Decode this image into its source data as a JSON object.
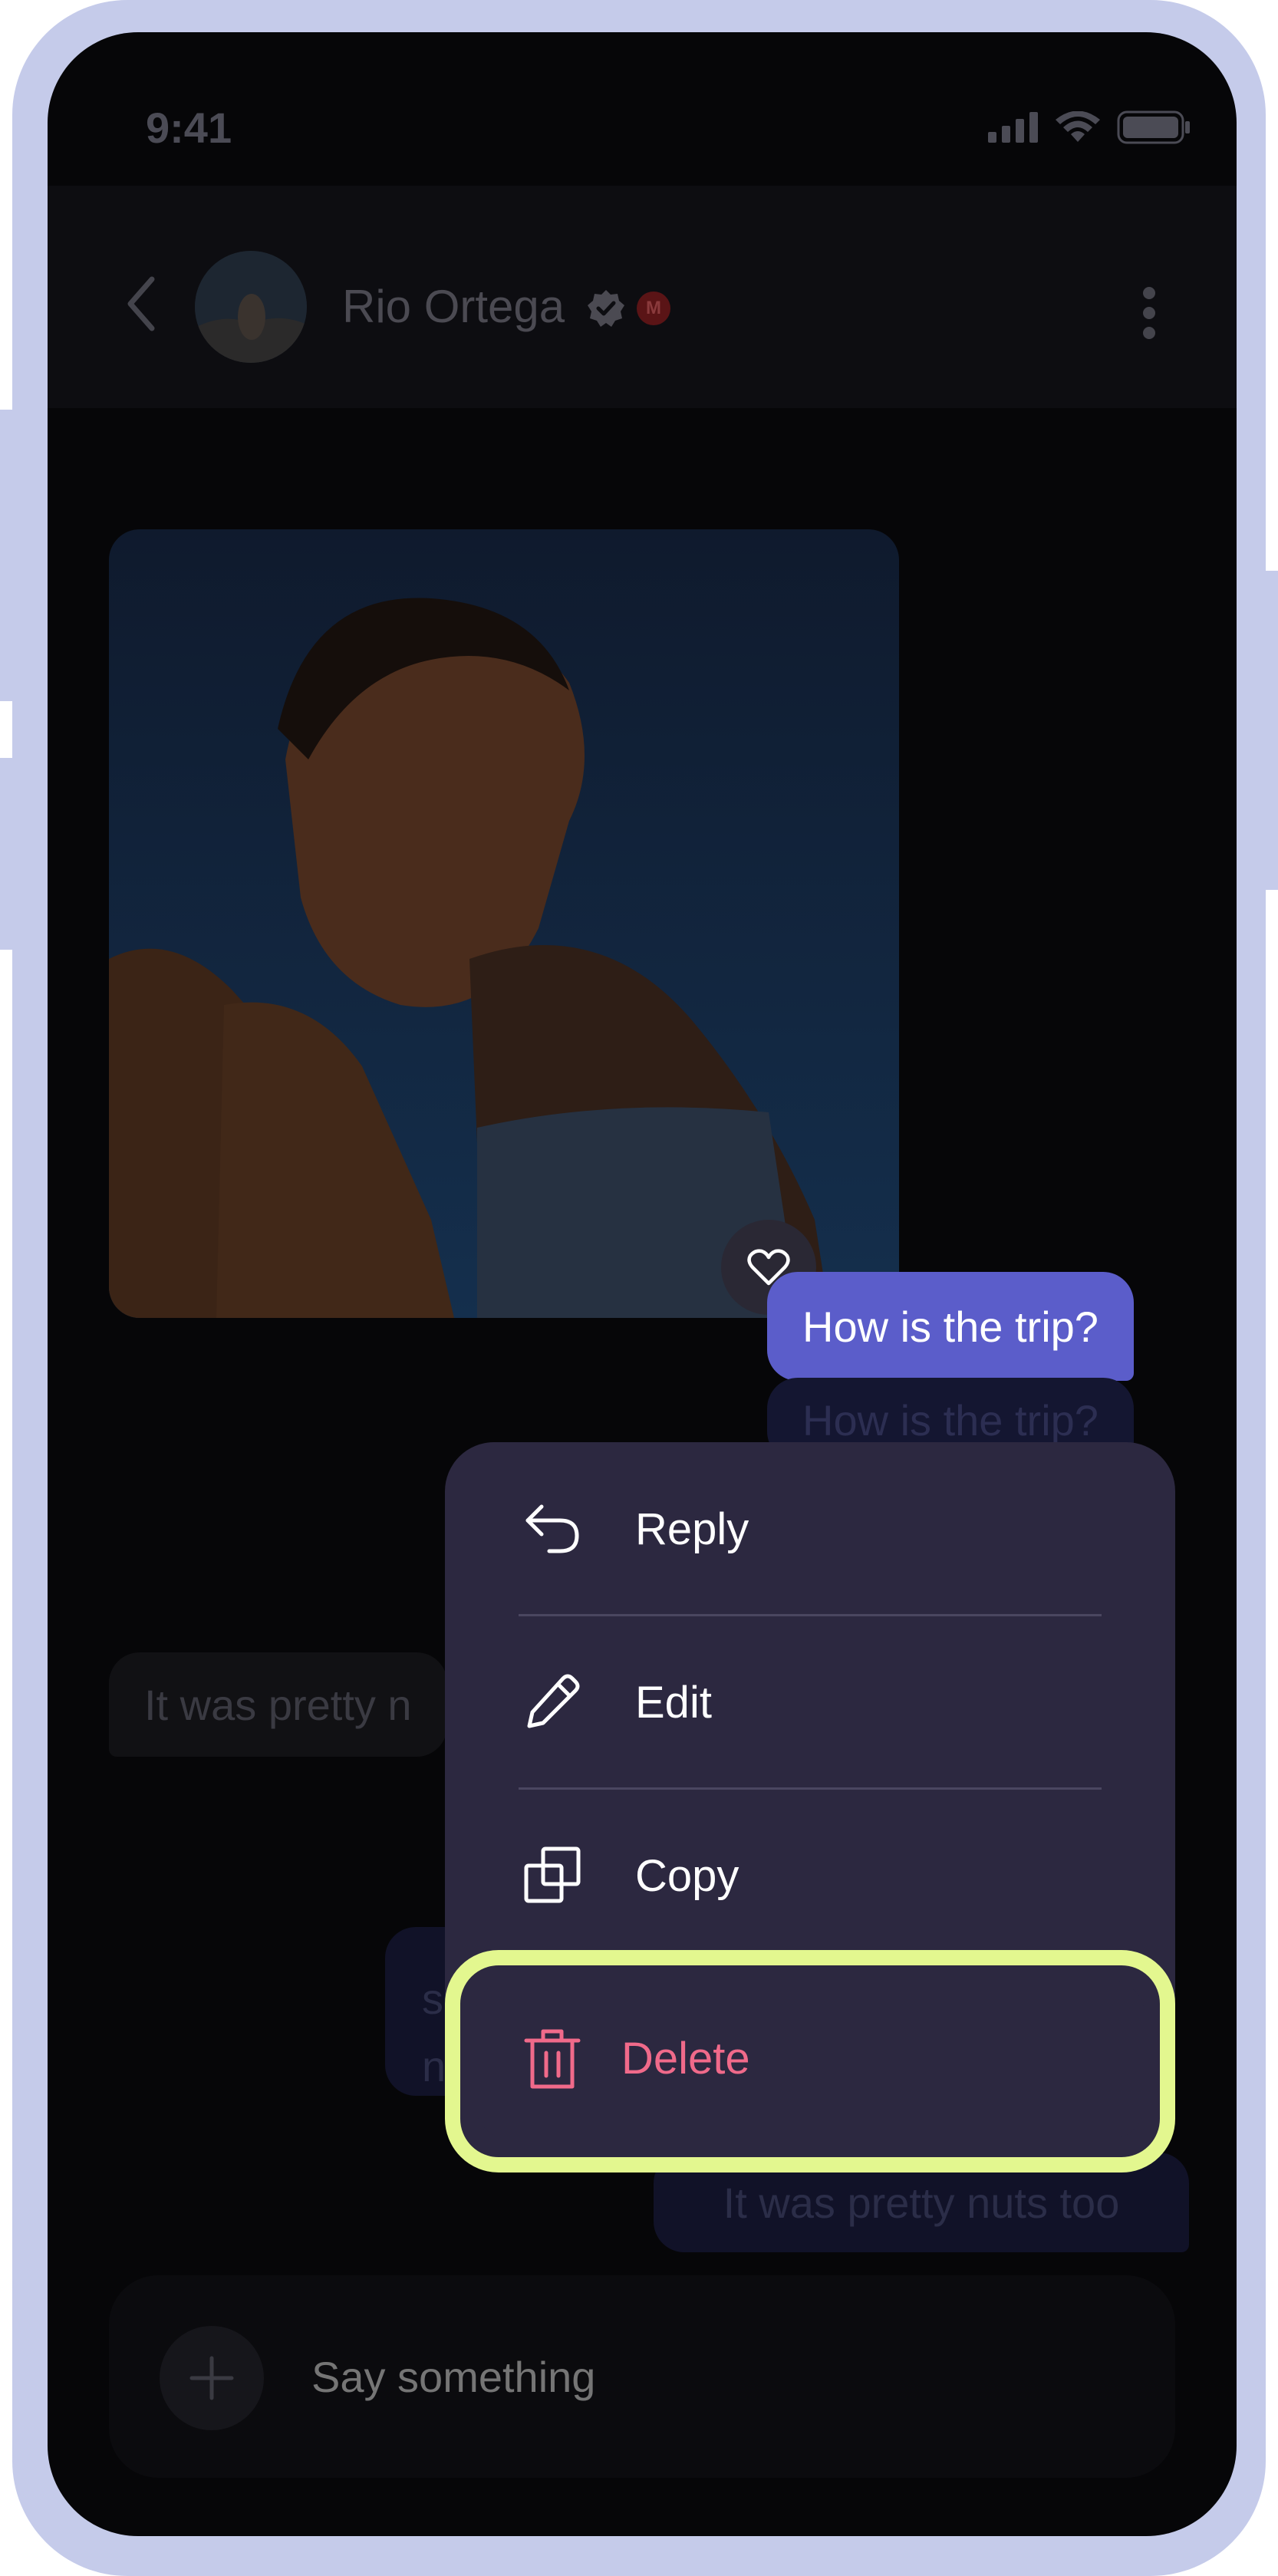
{
  "status_bar": {
    "time": "9:41"
  },
  "header": {
    "contact_name": "Rio Ortega",
    "badge_letter": "M",
    "icons": [
      "back-chevron-icon",
      "verified-icon",
      "more-vertical-icon"
    ]
  },
  "messages": {
    "sent_1": "How is the trip?",
    "sent_1_dim": "How is the trip?",
    "received_1": "It was pretty n",
    "sent_2_partial_line1": "s",
    "sent_2_partial_line2": "n",
    "sent_3": "It was pretty nuts too"
  },
  "reaction": {
    "icon": "heart-icon"
  },
  "context_menu": {
    "items": [
      {
        "label": "Reply",
        "icon": "reply-icon"
      },
      {
        "label": "Edit",
        "icon": "pencil-icon"
      },
      {
        "label": "Copy",
        "icon": "copy-icon"
      },
      {
        "label": "Delete",
        "icon": "trash-icon",
        "color": "#f06a8a"
      }
    ],
    "highlight_color": "#e3f78f"
  },
  "composer": {
    "placeholder": "Say something",
    "icon": "plus-icon"
  },
  "colors": {
    "frame": "#c5cbea",
    "sent_bubble": "#5b5dca",
    "menu_bg": "#2c2840",
    "delete": "#f06a8a"
  }
}
